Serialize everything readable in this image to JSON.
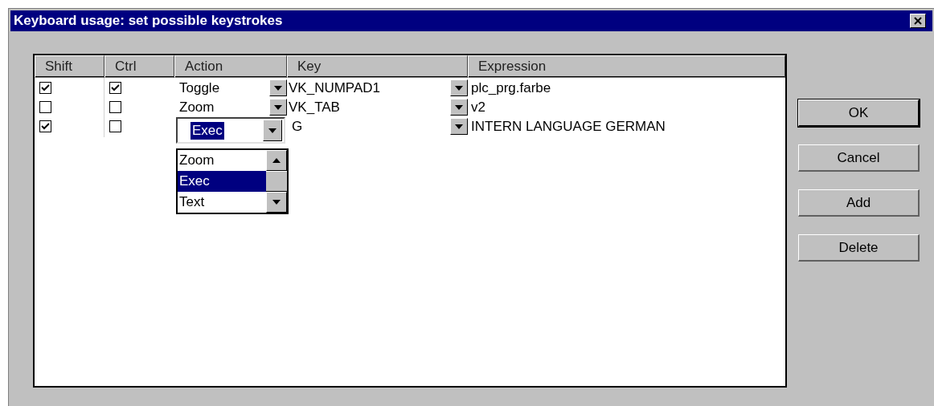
{
  "window": {
    "title": "Keyboard usage: set possible keystrokes"
  },
  "table": {
    "columns": [
      "Shift",
      "Ctrl",
      "Action",
      "Key",
      "Expression"
    ],
    "rows": [
      {
        "shift": true,
        "ctrl": true,
        "action": "Toggle",
        "key": "VK_NUMPAD1",
        "expression": "plc_prg.farbe"
      },
      {
        "shift": false,
        "ctrl": false,
        "action": "Zoom",
        "key": "VK_TAB",
        "expression": "v2"
      },
      {
        "shift": true,
        "ctrl": false,
        "action": "Exec",
        "key": "G",
        "expression": "INTERN LANGUAGE GERMAN",
        "dropdown": {
          "options": [
            {
              "label": "Zoom",
              "selected": false
            },
            {
              "label": "Exec",
              "selected": true
            },
            {
              "label": "Text",
              "selected": false
            }
          ]
        }
      }
    ]
  },
  "buttons": [
    {
      "label": "OK",
      "default": true
    },
    {
      "label": "Cancel",
      "default": false
    },
    {
      "label": "Add",
      "default": false
    },
    {
      "label": "Delete",
      "default": false
    }
  ]
}
